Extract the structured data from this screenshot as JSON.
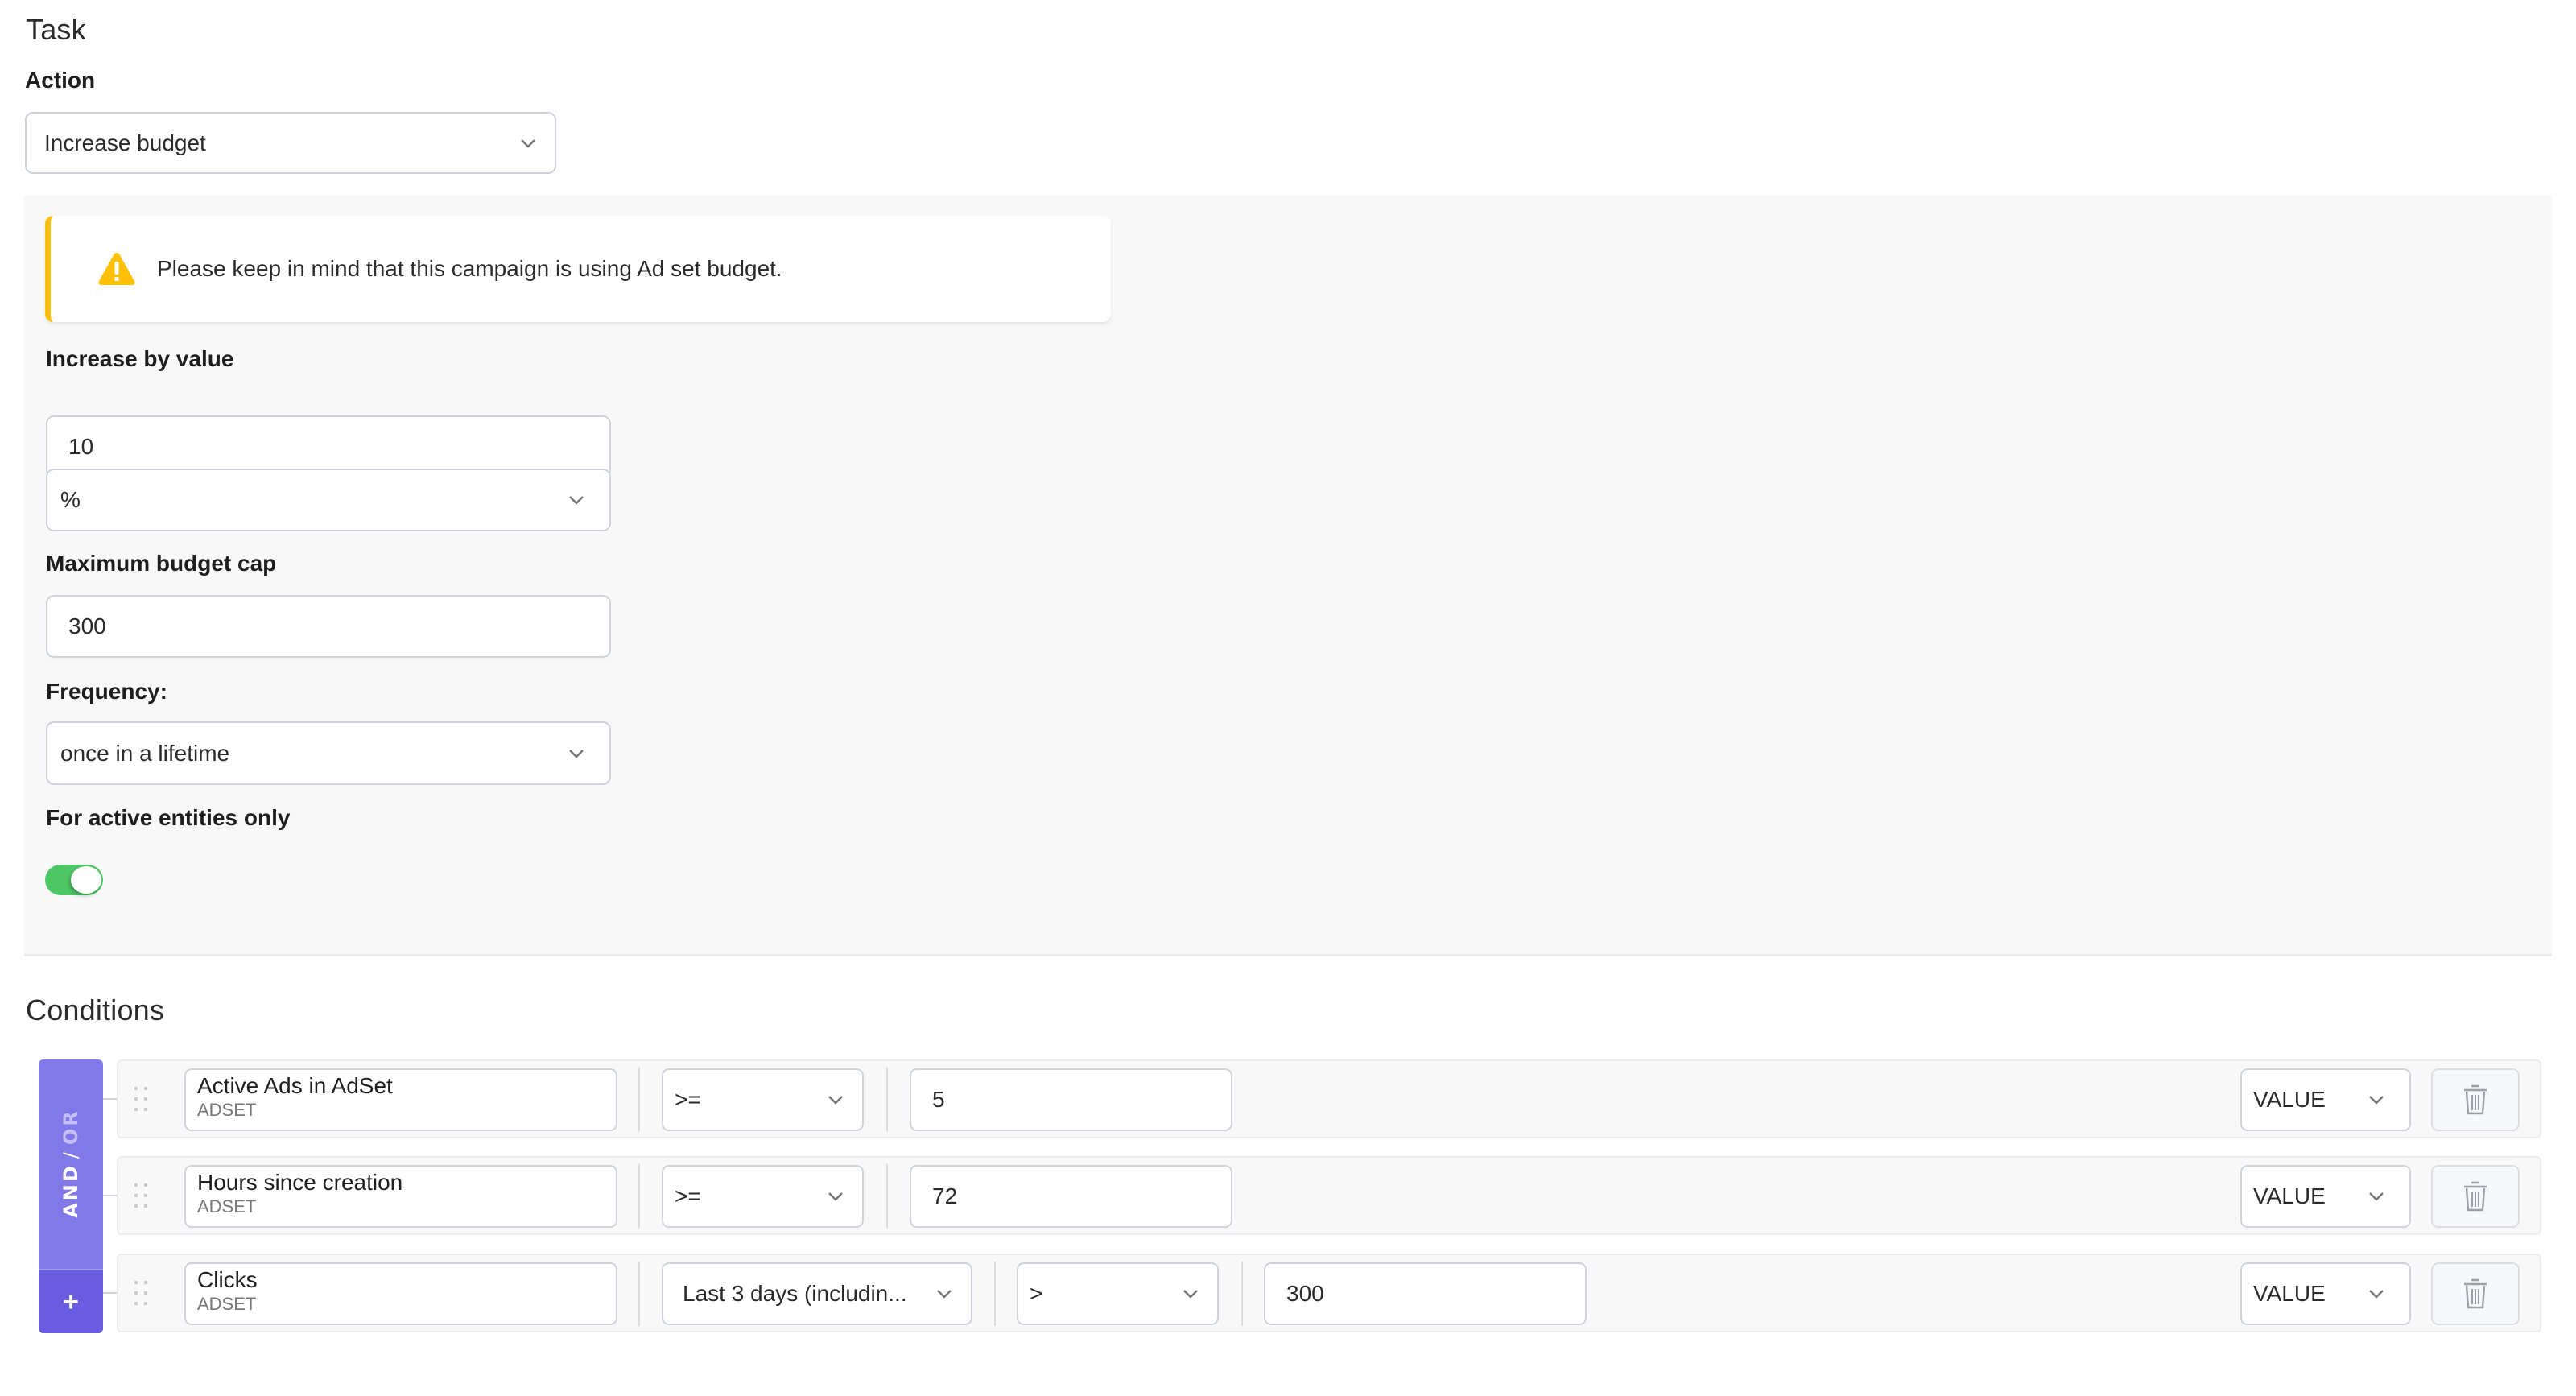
{
  "task": {
    "title": "Task",
    "action_label": "Action",
    "action_value": "Increase budget"
  },
  "alert": {
    "icon": "warning-icon",
    "message": "Please keep in mind that this campaign is using Ad set budget.",
    "color": "#ffc107"
  },
  "settings": {
    "increase_label": "Increase by value",
    "increase_value": "10",
    "unit_value": "%",
    "cap_label": "Maximum budget cap",
    "cap_value": "300",
    "frequency_label": "Frequency:",
    "frequency_value": "once in a lifetime",
    "active_label": "For active entities only",
    "active_enabled": true,
    "toggle_color": "#4cc764"
  },
  "conditions": {
    "title": "Conditions",
    "logic": {
      "and": "AND",
      "slash": "/",
      "or": "OR",
      "add": "+"
    },
    "accent": "#8178ea",
    "rows": [
      {
        "metric": "Active Ads in AdSet",
        "scope": "ADSET",
        "operator": ">=",
        "value": "5",
        "value_type": "VALUE"
      },
      {
        "metric": "Hours since creation",
        "scope": "ADSET",
        "operator": ">=",
        "value": "72",
        "value_type": "VALUE"
      },
      {
        "metric": "Clicks",
        "scope": "ADSET",
        "period": "Last 3 days (includin...",
        "operator": ">",
        "value": "300",
        "value_type": "VALUE"
      }
    ]
  }
}
